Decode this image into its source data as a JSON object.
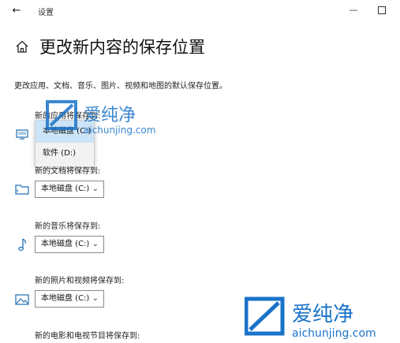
{
  "window": {
    "title": "设置",
    "back_glyph": "←",
    "minimize_glyph": "—"
  },
  "header": {
    "title": "更改新内容的保存位置",
    "description": "更改应用、文档、音乐、图片、视频和地图的默认保存位置。"
  },
  "sections": [
    {
      "label": "新的应用将保存到:",
      "icon": "monitor-icon",
      "value": "本地磁盘 (C:)"
    },
    {
      "label": "新的文档将保存到:",
      "icon": "folder-icon",
      "value": "本地磁盘 (C:)"
    },
    {
      "label": "新的音乐将保存到:",
      "icon": "music-note-icon",
      "value": "本地磁盘 (C:)"
    },
    {
      "label": "新的照片和视频将保存到:",
      "icon": "picture-icon",
      "value": "本地磁盘 (C:)"
    },
    {
      "label": "新的电影和电视节目将保存到:",
      "icon": "",
      "value": ""
    }
  ],
  "dropdown": {
    "options": [
      "本地磁盘 (C:)",
      "软件 (D:)"
    ],
    "selected_index": 0
  },
  "watermark": {
    "brand": "爱纯净",
    "url": "aichunjing.com"
  },
  "colors": {
    "accent": "#0078d7",
    "selected_bg": "#cce4f7",
    "watermark_blue": "#1a73c9"
  }
}
